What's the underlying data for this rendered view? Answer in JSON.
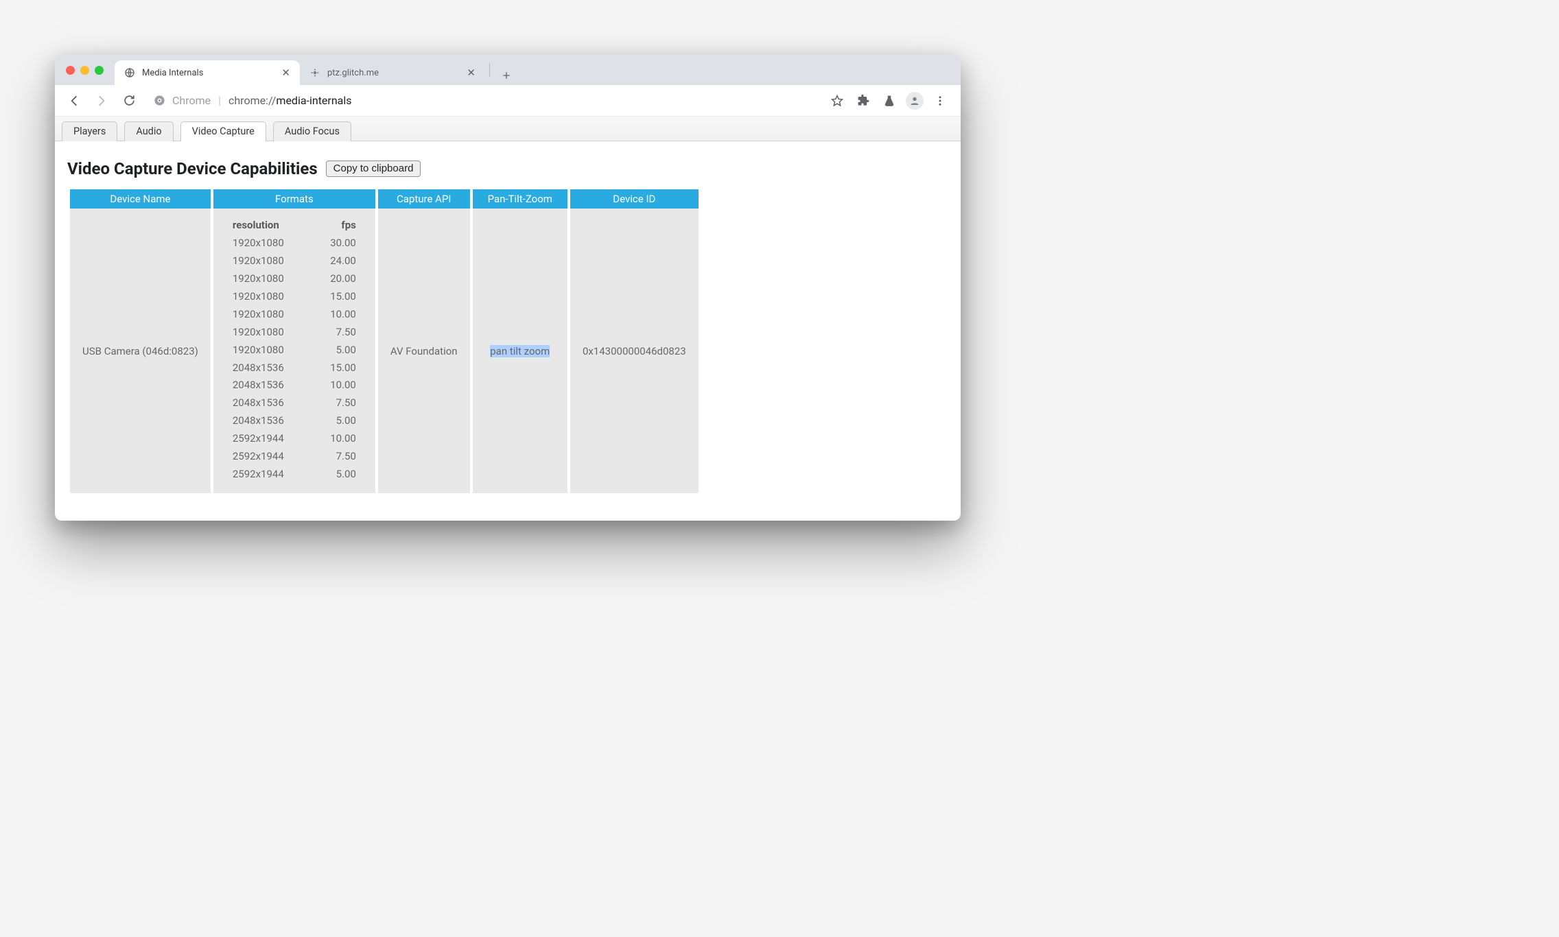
{
  "browser": {
    "tabs": [
      {
        "title": "Media Internals",
        "active": true
      },
      {
        "title": "ptz.glitch.me",
        "active": false
      }
    ]
  },
  "omnibox": {
    "origin_label": "Chrome",
    "scheme": "chrome://",
    "path": "media-internals"
  },
  "subtabs": [
    "Players",
    "Audio",
    "Video Capture",
    "Audio Focus"
  ],
  "active_subtab": "Video Capture",
  "heading": "Video Capture Device Capabilities",
  "copy_label": "Copy to clipboard",
  "columns": [
    "Device Name",
    "Formats",
    "Capture API",
    "Pan-Tilt-Zoom",
    "Device ID"
  ],
  "formats_header": {
    "res": "resolution",
    "fps": "fps"
  },
  "row": {
    "device_name": "USB Camera (046d:0823)",
    "capture_api": "AV Foundation",
    "ptz": "pan tilt zoom",
    "device_id": "0x14300000046d0823",
    "formats": [
      {
        "res": "1920x1080",
        "fps": "30.00"
      },
      {
        "res": "1920x1080",
        "fps": "24.00"
      },
      {
        "res": "1920x1080",
        "fps": "20.00"
      },
      {
        "res": "1920x1080",
        "fps": "15.00"
      },
      {
        "res": "1920x1080",
        "fps": "10.00"
      },
      {
        "res": "1920x1080",
        "fps": "7.50"
      },
      {
        "res": "1920x1080",
        "fps": "5.00"
      },
      {
        "res": "2048x1536",
        "fps": "15.00"
      },
      {
        "res": "2048x1536",
        "fps": "10.00"
      },
      {
        "res": "2048x1536",
        "fps": "7.50"
      },
      {
        "res": "2048x1536",
        "fps": "5.00"
      },
      {
        "res": "2592x1944",
        "fps": "10.00"
      },
      {
        "res": "2592x1944",
        "fps": "7.50"
      },
      {
        "res": "2592x1944",
        "fps": "5.00"
      }
    ]
  }
}
